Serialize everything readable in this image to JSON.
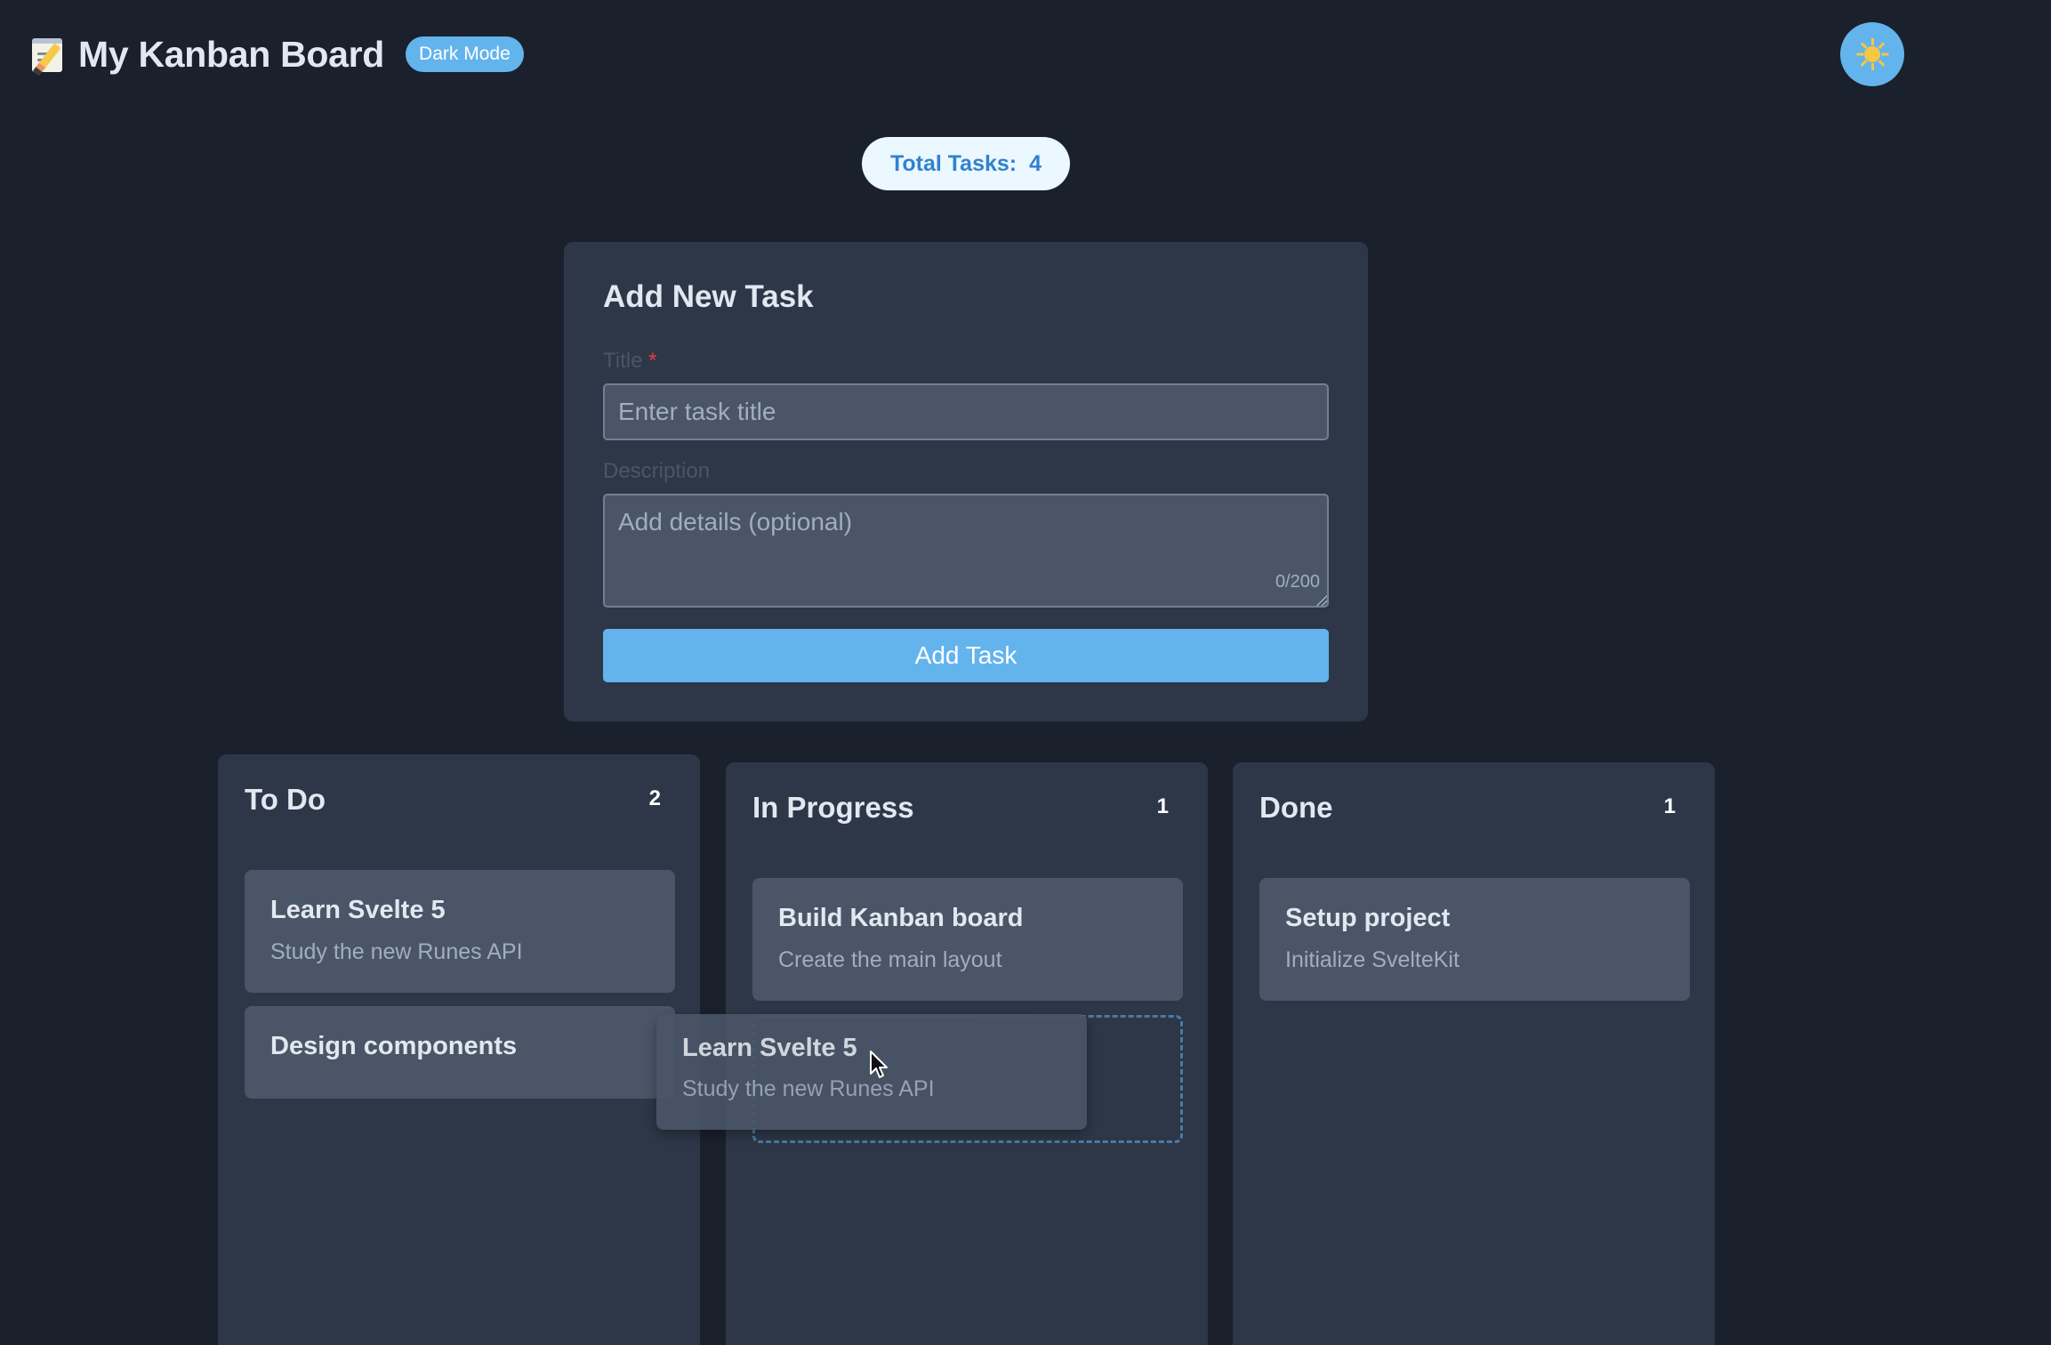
{
  "header": {
    "title": "My Kanban Board",
    "mode_badge": "Dark Mode"
  },
  "theme_toggle": {
    "icon": "sun-icon"
  },
  "total": {
    "label": "Total Tasks:",
    "count": "4"
  },
  "form": {
    "heading": "Add New Task",
    "title_label": "Title",
    "required_mark": "*",
    "title_placeholder": "Enter task title",
    "title_value": "",
    "description_label": "Description",
    "description_placeholder": "Add details (optional)",
    "description_value": "",
    "char_count": "0/200",
    "submit_label": "Add Task"
  },
  "columns": [
    {
      "title": "To Do",
      "count": "2",
      "cards": [
        {
          "title": "Learn Svelte 5",
          "description": "Study the new Runes API"
        },
        {
          "title": "Design components",
          "description": ""
        }
      ]
    },
    {
      "title": "In Progress",
      "count": "1",
      "cards": [
        {
          "title": "Build Kanban board",
          "description": "Create the main layout"
        }
      ]
    },
    {
      "title": "Done",
      "count": "1",
      "cards": [
        {
          "title": "Setup project",
          "description": "Initialize SvelteKit"
        }
      ]
    }
  ],
  "dragging_card": {
    "title": "Learn Svelte 5",
    "description": "Study the new Runes API"
  },
  "colors": {
    "background": "#1a202c",
    "surface": "#2d3748",
    "card": "#4a5568",
    "accent": "#63b3ed"
  }
}
